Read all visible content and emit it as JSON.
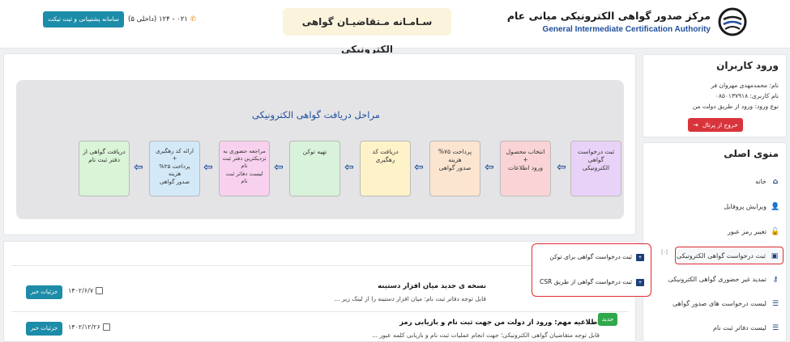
{
  "header": {
    "org_name_fa": "مرکز صدور گواهی الکترونیکی میانی عام",
    "org_name_en": "General Intermediate Certification Authority",
    "system_title": "سـامـانه مـتقاضیـان گواهی الکترونیکی",
    "phone": "۰۲۱ - ۱۲۴ (داخلی ۵)",
    "support_button": "سامانه پشتیبانی و ثبت تیکت"
  },
  "login": {
    "title": "ورود کاربران",
    "name_line": "نام: محمدمهدی مهروان فر",
    "username_line": "نام کاربری: ۰۸۵۰۱۳۷۹۱۸",
    "login_type_line": "نوع ورود: ورود از طریق دولت من",
    "logout_button": "خروج از پرتال"
  },
  "menu": {
    "title": "منوی اصلی",
    "items": [
      {
        "label": "خانه",
        "icon": "home-icon"
      },
      {
        "label": "ویرایش پروفایل",
        "icon": "user-edit-icon"
      },
      {
        "label": "تغییر رمز عبور",
        "icon": "lock-icon"
      },
      {
        "label": "ثبت درخواست گواهی الکترونیکی",
        "icon": "folder-plus-icon"
      },
      {
        "label": "تمدید غیر حضوری گواهی الکترونیکی",
        "icon": "key-icon"
      },
      {
        "label": "لیست درخواست های صدور گواهی",
        "icon": "list-icon"
      },
      {
        "label": "لیست دفاتر ثبت نام",
        "icon": "list-icon"
      }
    ],
    "collapse_mark": "[-]"
  },
  "submenu": {
    "items": [
      {
        "label": "ثبت درخواست گواهی برای توکن",
        "icon": "folder-icon"
      },
      {
        "label": "ثبت درخواست گواهی از طریق CSR",
        "icon": "folder-icon"
      }
    ]
  },
  "steps": {
    "title": "مراحل دریافت گواهی الکترونیکی",
    "items": [
      {
        "text": "ثبت درخواست\nگواهی الکترونیکی",
        "color": "#e9d2f7"
      },
      {
        "text": "انتخاب محصول\n+\nورود اطلاعات",
        "color": "#f9d3d5"
      },
      {
        "text": "پرداخت ۷۵%\nهزینه\nصدور گواهی",
        "color": "#fbe4d0"
      },
      {
        "text": "دریافت کد\nرهگیری",
        "color": "#fdf2c8"
      },
      {
        "text": "تهیه توکن",
        "color": "#d9f3da"
      },
      {
        "text": "مراجعه حضوری به\nنزدیکترین دفتر ثبت\nنام\nلیست دفاتر ثبت نام",
        "color": "#f8d1ee"
      },
      {
        "text": "ارائه کد رهگیری\n+\nپرداخت ۲۵% هزینه\nصدور گواهی",
        "color": "#d3e9f8"
      },
      {
        "text": "دریافت گواهی از\nدفتر ثبت نام",
        "color": "#d9f4d6"
      }
    ]
  },
  "news": {
    "items": [
      {
        "title": "نسخه ی جدید میان افزار دستینه",
        "desc": "قابل توجه دفاتر ثبت نام: میان افزار دستینه را از لینک زیر ...",
        "date": "۱۴۰۲/۶/۷",
        "button": "جزئیات خبر"
      },
      {
        "title": "اطلاعیه مهم: ورود از دولت من جهت ثبت نام و بازیابی رمز",
        "desc": "قابل توجه متقاضیان گواهی الکترونیکی؛ جهت انجام عملیات ثبت نام و بازیابی کلمه عبور ...",
        "date": "۱۴۰۲/۱۲/۲۶",
        "button": "جزئیات خبر",
        "badge": "جدید"
      }
    ]
  },
  "colors": {
    "brand_blue": "#1f4f9c",
    "teal_button": "#1c8ca8",
    "danger": "#d9343b",
    "highlight": "#e02b32",
    "new_badge": "#2ea84b"
  }
}
